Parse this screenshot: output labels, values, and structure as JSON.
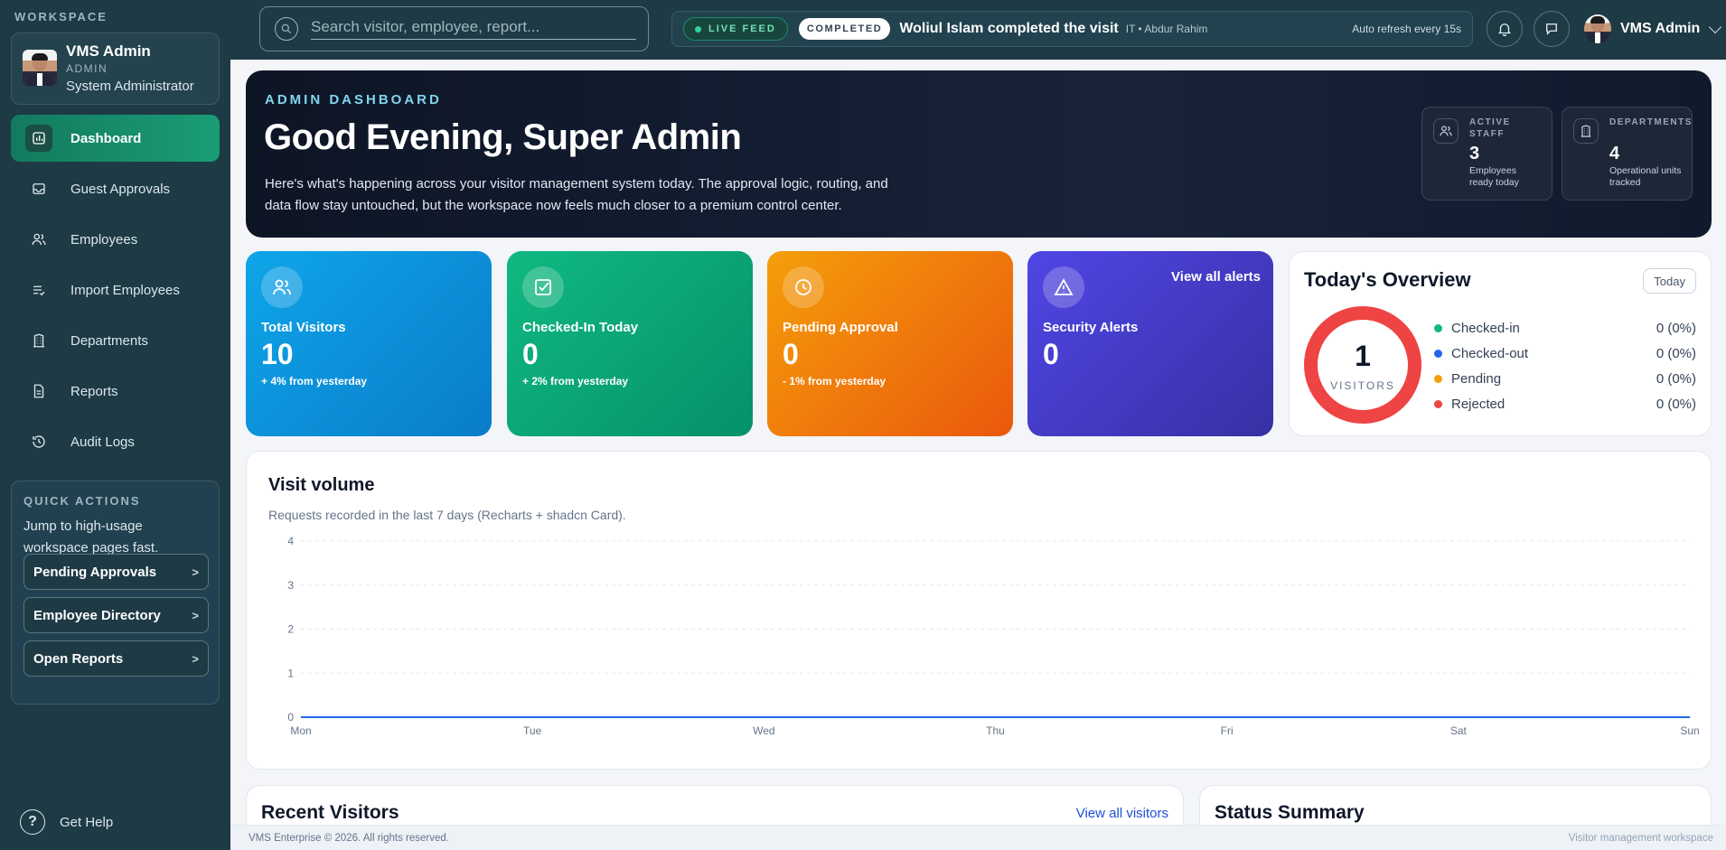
{
  "sidebar": {
    "workspace_label": "WORKSPACE",
    "profile": {
      "name": "VMS Admin",
      "role": "ADMIN",
      "title": "System Administrator"
    },
    "items": [
      {
        "label": "Dashboard",
        "icon": "dashboard-icon",
        "active": true
      },
      {
        "label": "Guest Approvals",
        "icon": "inbox-icon"
      },
      {
        "label": "Employees",
        "icon": "users-icon"
      },
      {
        "label": "Import Employees",
        "icon": "list-check-icon"
      },
      {
        "label": "Departments",
        "icon": "building-icon"
      },
      {
        "label": "Reports",
        "icon": "file-icon"
      },
      {
        "label": "Audit Logs",
        "icon": "history-icon"
      }
    ],
    "quick_actions": {
      "title": "QUICK ACTIONS",
      "description": "Jump to high-usage workspace pages fast.",
      "buttons": [
        {
          "label": "Pending Approvals",
          "chevron": ">"
        },
        {
          "label": "Employee Directory",
          "chevron": ">"
        },
        {
          "label": "Open Reports",
          "chevron": ">"
        }
      ]
    },
    "help_label": "Get Help",
    "help_glyph": "?"
  },
  "topbar": {
    "search_placeholder": "Search visitor, employee, report...",
    "feed": {
      "live_label": "LIVE FEED",
      "status_label": "COMPLETED",
      "message": "Woliul Islam completed the visit",
      "meta": "IT • Abdur Rahim",
      "refresh": "Auto refresh every 15s"
    },
    "user_name": "VMS Admin"
  },
  "hero": {
    "eyebrow": "ADMIN DASHBOARD",
    "title": "Good Evening, Super Admin",
    "description": "Here's what's happening across your visitor management system today. The approval logic, routing, and data flow stay untouched, but the workspace now feels much closer to a premium control center.",
    "stats": [
      {
        "label": "ACTIVE STAFF",
        "value": "3",
        "sub": "Employees ready today",
        "icon": "users-icon"
      },
      {
        "label": "DEPARTMENTS",
        "value": "4",
        "sub": "Operational units tracked",
        "icon": "building-icon"
      }
    ]
  },
  "kpis": [
    {
      "label": "Total Visitors",
      "value": "10",
      "delta": "+ 4% from yesterday",
      "icon": "users-icon",
      "from": "#0ea5e9",
      "to": "#0a7cc9"
    },
    {
      "label": "Checked-In Today",
      "value": "0",
      "delta": "+ 2% from yesterday",
      "icon": "check-square-icon",
      "from": "#10b981",
      "to": "#05906a"
    },
    {
      "label": "Pending Approval",
      "value": "0",
      "delta": "- 1% from yesterday",
      "icon": "clock-icon",
      "from": "#f59e0b",
      "to": "#ea580c"
    },
    {
      "label": "Security Alerts",
      "value": "0",
      "delta": "",
      "icon": "alert-triangle-icon",
      "link": "View all alerts",
      "from": "#4f46e5",
      "to": "#3730a3"
    }
  ],
  "overview": {
    "title": "Today's Overview",
    "filter": "Today",
    "total": "1",
    "total_label": "VISITORS",
    "legend": [
      {
        "label": "Checked-in",
        "value": "0 (0%)",
        "color": "#10b981"
      },
      {
        "label": "Checked-out",
        "value": "0 (0%)",
        "color": "#2563eb"
      },
      {
        "label": "Pending",
        "value": "0 (0%)",
        "color": "#f59e0b"
      },
      {
        "label": "Rejected",
        "value": "0 (0%)",
        "color": "#ef4444"
      }
    ],
    "ring_color": "#ef4444"
  },
  "visit_volume": {
    "title": "Visit volume",
    "subtitle": "Requests recorded in the last 7 days (Recharts + shadcn Card)."
  },
  "chart_data": {
    "type": "line",
    "categories": [
      "Mon",
      "Tue",
      "Wed",
      "Thu",
      "Fri",
      "Sat",
      "Sun"
    ],
    "values": [
      0,
      0,
      0,
      0,
      0,
      0,
      0
    ],
    "ylim": [
      0,
      4
    ],
    "yticks": [
      "0",
      "1",
      "2",
      "3",
      "4"
    ],
    "grid": true,
    "line_color": "#2563eb"
  },
  "bottom": {
    "recent_title": "Recent Visitors",
    "recent_link": "View all visitors",
    "status_title": "Status Summary"
  },
  "footer": {
    "left": "VMS Enterprise © 2026. All rights reserved.",
    "right": "Visitor management workspace"
  }
}
